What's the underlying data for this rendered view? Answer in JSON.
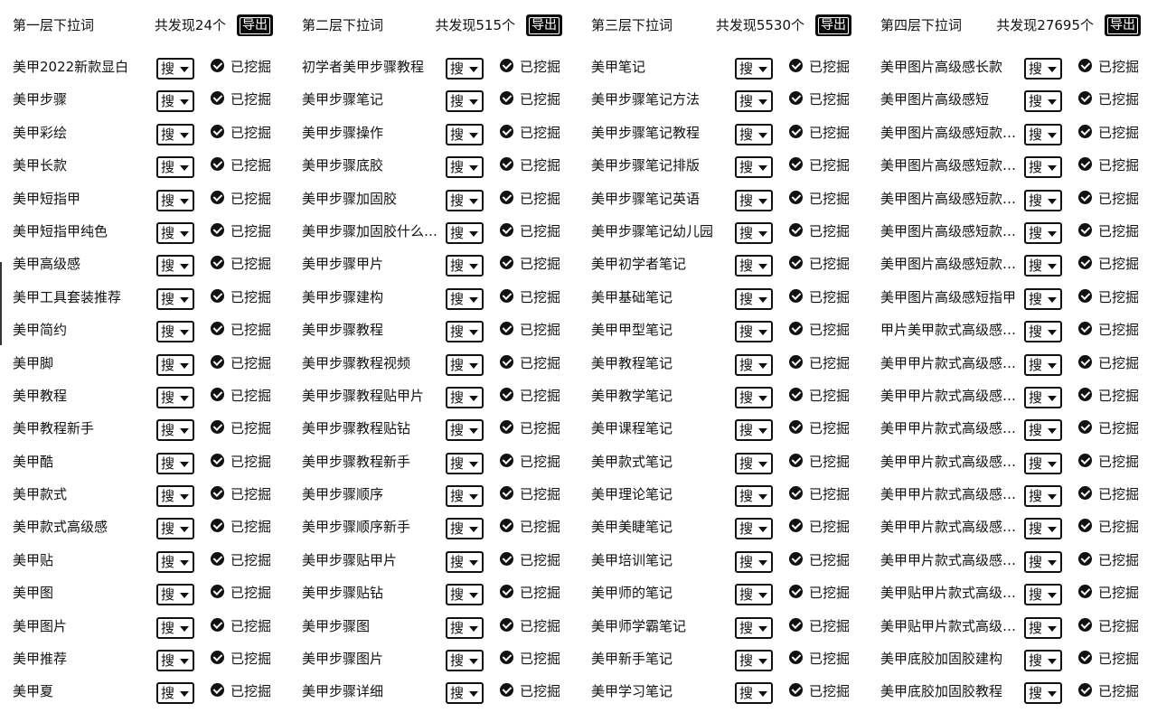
{
  "search_label": "搜",
  "mined_label": "已挖掘",
  "export_label": "导出",
  "columns": [
    {
      "title": "第一层下拉词",
      "count": "共发现24个",
      "keywords": [
        "美甲2022新款显白",
        "美甲步骤",
        "美甲彩绘",
        "美甲长款",
        "美甲短指甲",
        "美甲短指甲纯色",
        "美甲高级感",
        "美甲工具套装推荐",
        "美甲简约",
        "美甲脚",
        "美甲教程",
        "美甲教程新手",
        "美甲酷",
        "美甲款式",
        "美甲款式高级感",
        "美甲贴",
        "美甲图",
        "美甲图片",
        "美甲推荐",
        "美甲夏"
      ]
    },
    {
      "title": "第二层下拉词",
      "count": "共发现515个",
      "keywords": [
        "初学者美甲步骤教程",
        "美甲步骤笔记",
        "美甲步骤操作",
        "美甲步骤底胶",
        "美甲步骤加固胶",
        "美甲步骤加固胶什么…",
        "美甲步骤甲片",
        "美甲步骤建构",
        "美甲步骤教程",
        "美甲步骤教程视频",
        "美甲步骤教程贴甲片",
        "美甲步骤教程贴钻",
        "美甲步骤教程新手",
        "美甲步骤顺序",
        "美甲步骤顺序新手",
        "美甲步骤贴甲片",
        "美甲步骤贴钻",
        "美甲步骤图",
        "美甲步骤图片",
        "美甲步骤详细"
      ]
    },
    {
      "title": "第三层下拉词",
      "count": "共发现5530个",
      "keywords": [
        "美甲笔记",
        "美甲步骤笔记方法",
        "美甲步骤笔记教程",
        "美甲步骤笔记排版",
        "美甲步骤笔记英语",
        "美甲步骤笔记幼儿园",
        "美甲初学者笔记",
        "美甲基础笔记",
        "美甲甲型笔记",
        "美甲教程笔记",
        "美甲教学笔记",
        "美甲课程笔记",
        "美甲款式笔记",
        "美甲理论笔记",
        "美甲美睫笔记",
        "美甲培训笔记",
        "美甲师的笔记",
        "美甲师学霸笔记",
        "美甲新手笔记",
        "美甲学习笔记"
      ]
    },
    {
      "title": "第四层下拉词",
      "count": "共发现27695个",
      "keywords": [
        "美甲图片高级感长款",
        "美甲图片高级感短",
        "美甲图片高级感短款…",
        "美甲图片高级感短款…",
        "美甲图片高级感短款…",
        "美甲图片高级感短款…",
        "美甲图片高级感短款…",
        "美甲图片高级感短指甲",
        "甲片美甲款式高级感…",
        "美甲甲片款式高级感…",
        "美甲甲片款式高级感…",
        "美甲甲片款式高级感…",
        "美甲甲片款式高级感…",
        "美甲甲片款式高级感…",
        "美甲甲片款式高级感…",
        "美甲甲片款式高级感…",
        "美甲贴甲片款式高级…",
        "美甲贴甲片款式高级…",
        "美甲底胶加固胶建构",
        "美甲底胶加固胶教程"
      ]
    }
  ]
}
